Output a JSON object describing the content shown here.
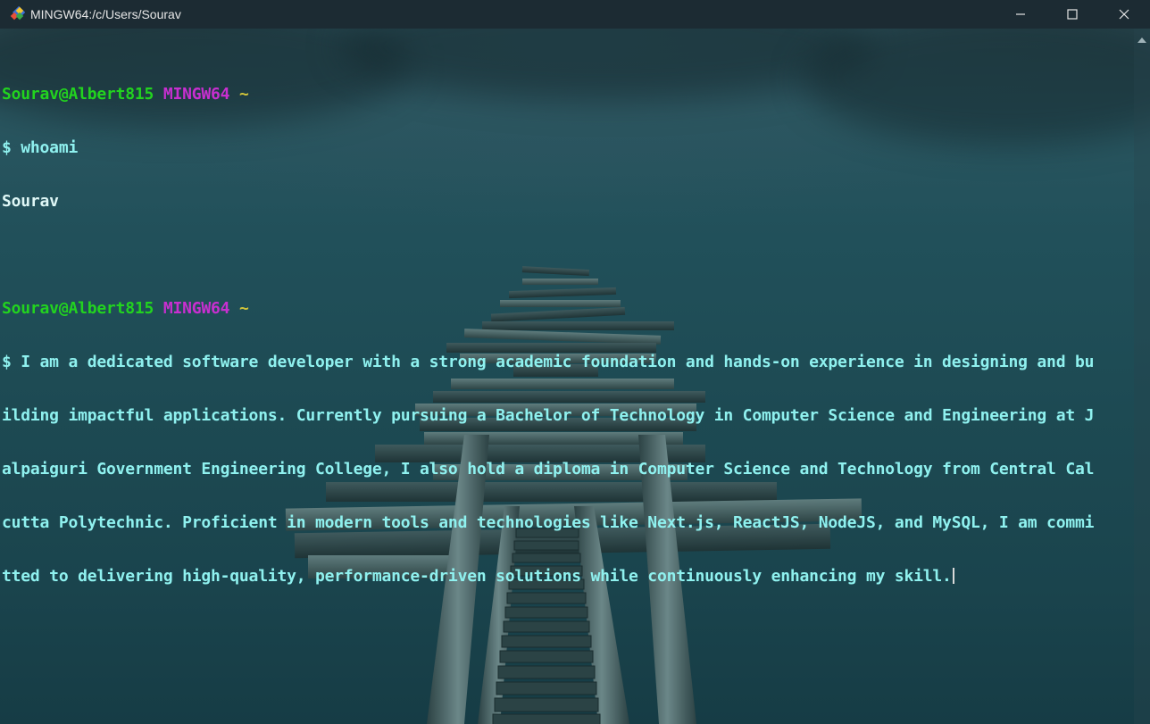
{
  "window": {
    "title": "MINGW64:/c/Users/Sourav",
    "controls": {
      "minimize": "minimize-icon",
      "maximize": "maximize-icon",
      "close": "close-icon"
    }
  },
  "terminal": {
    "colors": {
      "user_host": "#22d31f",
      "env": "#c82fd0",
      "path": "#d1c43a",
      "command_text": "#8ff1ef"
    },
    "blocks": [
      {
        "prompt": {
          "user_host": "Sourav@Albert815",
          "env": "MINGW64",
          "path": "~"
        },
        "command": "$ whoami",
        "output": [
          "Sourav"
        ]
      },
      {
        "prompt": {
          "user_host": "Sourav@Albert815",
          "env": "MINGW64",
          "path": "~"
        },
        "command_lines": [
          "$ I am a dedicated software developer with a strong academic foundation and hands-on experience in designing and bu",
          "ilding impactful applications. Currently pursuing a Bachelor of Technology in Computer Science and Engineering at J",
          "alpaiguri Government Engineering College, I also hold a diploma in Computer Science and Technology from Central Cal",
          "cutta Polytechnic. Proficient in modern tools and technologies like Next.js, ReactJS, NodeJS, and MySQL, I am commi",
          "tted to delivering high-quality, performance-driven solutions while continuously enhancing my skill."
        ]
      }
    ]
  }
}
